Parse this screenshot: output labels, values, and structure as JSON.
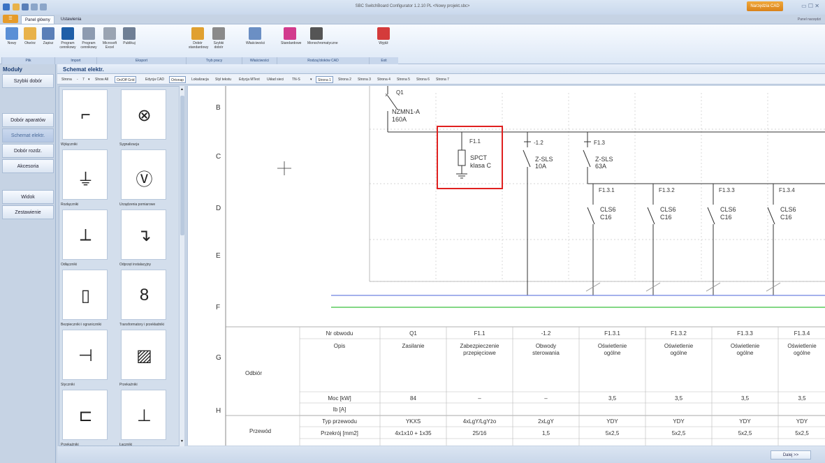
{
  "window": {
    "title": "SBC SwitchBoard Configurator 1.2.10 PL  <Nowy projekt.sbc>",
    "cad_button": "Narzędzia CAD",
    "panel_label": "Panel narzędzi"
  },
  "ribbon": {
    "tabs": [
      "Panel główny",
      "Ustawienia"
    ],
    "buttons": [
      {
        "label": "Nowy",
        "icon": "new-file-icon",
        "color": "#5a8fd6"
      },
      {
        "label": "Otwórz",
        "icon": "open-folder-icon",
        "color": "#e8b24a"
      },
      {
        "label": "Zapisz",
        "icon": "save-icon",
        "color": "#5a7fb8"
      },
      {
        "label": "Program cennikowy",
        "icon": "etn-icon",
        "color": "#1f5fa8"
      },
      {
        "label": "Program cennikowy",
        "icon": "etn-grey-icon",
        "color": "#8d9bb0"
      },
      {
        "label": "Microsoft Excel",
        "icon": "excel-icon",
        "color": "#9aa4b2"
      },
      {
        "label": "Publikuj",
        "icon": "printer-icon",
        "color": "#6f7f95"
      },
      {
        "label": "Dobór standardowy",
        "icon": "standard-selection-icon",
        "color": "#e0a030"
      },
      {
        "label": "Szybki dobór",
        "icon": "quick-selection-icon",
        "color": "#8a8a8a"
      },
      {
        "label": "Właściwości",
        "icon": "properties-icon",
        "color": "#6b8fc4"
      },
      {
        "label": "Standardowe",
        "icon": "color-blocks-icon",
        "color": "#d23b8d"
      },
      {
        "label": "Monochromatyczne",
        "icon": "mono-blocks-icon",
        "color": "#555555"
      },
      {
        "label": "Wyjdź",
        "icon": "exit-icon",
        "color": "#d43b3b"
      }
    ],
    "groups": [
      "Plik",
      "Import",
      "Eksport",
      "Tryb pracy",
      "Właściwości",
      "Rodzaj bloków CAD",
      "Exit"
    ]
  },
  "sidebar": {
    "title": "Moduły",
    "items": [
      "Szybki dobór",
      "Dobór aparatów",
      "Schemat elektr.",
      "Dobór rozdz.",
      "Akcesoria",
      "Widok",
      "Zestawienie"
    ]
  },
  "content": {
    "title": "Schemat elektr.",
    "toolbar": {
      "page_label": "Strona",
      "page_value": "7",
      "items": [
        "Show All",
        "On/Off Grid",
        "Edycja CAD",
        "Ortonap",
        "Lokalizacja",
        "Styl tekstu",
        "Edycja MText"
      ],
      "network_label": "Układ sieci",
      "network_value": "TN-S",
      "pages": [
        "Strona 1",
        "Strona 2",
        "Strona 3",
        "Strona 4",
        "Strona 5",
        "Strona 6",
        "Strona 7"
      ]
    }
  },
  "palette": {
    "items": [
      "Wyłączniki",
      "Sygnalizacja",
      "Rozłączniki",
      "Urządzenia pomiarowe",
      "Odłączniki",
      "Odprzęt instalacyjny",
      "Bezpieczniki i ograniczniki",
      "Transformatory i przekładniki",
      "Styczniki",
      "Przekaźniki",
      "Przekaźniki",
      "Łączniki"
    ]
  },
  "schematic": {
    "row_labels": [
      "B",
      "C",
      "D",
      "E",
      "F",
      "G",
      "H"
    ],
    "main": {
      "id": "Q1",
      "type": "NZMN1-A",
      "rating": "160A"
    },
    "f11": {
      "id": "F1.1",
      "type": "SPCT",
      "class": "klasa C"
    },
    "c12": {
      "id": "-1.2",
      "type": "Z-SLS",
      "rating": "10A"
    },
    "f13": {
      "id": "F1.3",
      "type": "Z-SLS",
      "rating": "63A"
    },
    "sub": [
      {
        "id": "F1.3.1",
        "type": "CLS6",
        "rating": "C16"
      },
      {
        "id": "F1.3.2",
        "type": "CLS6",
        "rating": "C16"
      },
      {
        "id": "F1.3.3",
        "type": "CLS6",
        "rating": "C16"
      },
      {
        "id": "F1.3.4",
        "type": "CLS6",
        "rating": "C16"
      }
    ],
    "highlight_color": "#e0201f"
  },
  "table": {
    "odbior_label": "Odbiór",
    "przewod_label": "Przewód",
    "row_headers": [
      "Nr obwodu",
      "Opis",
      "Moc [kW]",
      "Ib [A]",
      "Typ przewodu",
      "Przekrój [mm2]"
    ],
    "columns": [
      {
        "nr": "Q1",
        "opis": "Zasilanie",
        "moc": "84",
        "ib": "",
        "typ": "YKXS",
        "przekroj": "4x1x10 + 1x35"
      },
      {
        "nr": "F1.1",
        "opis": "Zabezpieczenie przepięciowe",
        "moc": "–",
        "ib": "",
        "typ": "4xLgY/LgYżo",
        "przekroj": "25/16"
      },
      {
        "nr": "-1.2",
        "opis": "Obwody sterowania",
        "moc": "–",
        "ib": "",
        "typ": "2xLgY",
        "przekroj": "1,5"
      },
      {
        "nr": "F1.3.1",
        "opis": "Oświetlenie ogólne",
        "moc": "3,5",
        "ib": "",
        "typ": "YDY",
        "przekroj": "5x2,5"
      },
      {
        "nr": "F1.3.2",
        "opis": "Oświetlenie ogólne",
        "moc": "3,5",
        "ib": "",
        "typ": "YDY",
        "przekroj": "5x2,5"
      },
      {
        "nr": "F1.3.3",
        "opis": "Oświetlenie ogólne",
        "moc": "3,5",
        "ib": "",
        "typ": "YDY",
        "przekroj": "5x2,5"
      },
      {
        "nr": "F1.3.4",
        "opis": "Oświetlenie ogólne",
        "moc": "3,5",
        "ib": "",
        "typ": "YDY",
        "przekroj": "5x2,5"
      }
    ]
  },
  "status": {
    "next_button": "Dalej >>"
  }
}
